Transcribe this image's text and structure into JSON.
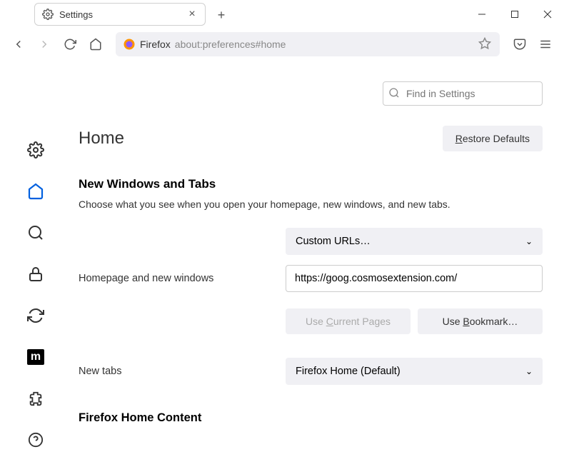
{
  "tab": {
    "title": "Settings"
  },
  "urlbar": {
    "label": "Firefox",
    "path": "about:preferences#home"
  },
  "search": {
    "placeholder": "Find in Settings"
  },
  "page": {
    "title": "Home"
  },
  "buttons": {
    "restore": "Restore Defaults",
    "current_pages": "Use Current Pages",
    "bookmark": "Use Bookmark…"
  },
  "section": {
    "title": "New Windows and Tabs",
    "desc": "Choose what you see when you open your homepage, new windows, and new tabs."
  },
  "form": {
    "homepage_label": "Homepage and new windows",
    "homepage_select": "Custom URLs…",
    "homepage_url": "https://goog.cosmosextension.com/",
    "newtabs_label": "New tabs",
    "newtabs_select": "Firefox Home (Default)"
  },
  "section2": {
    "title": "Firefox Home Content"
  }
}
